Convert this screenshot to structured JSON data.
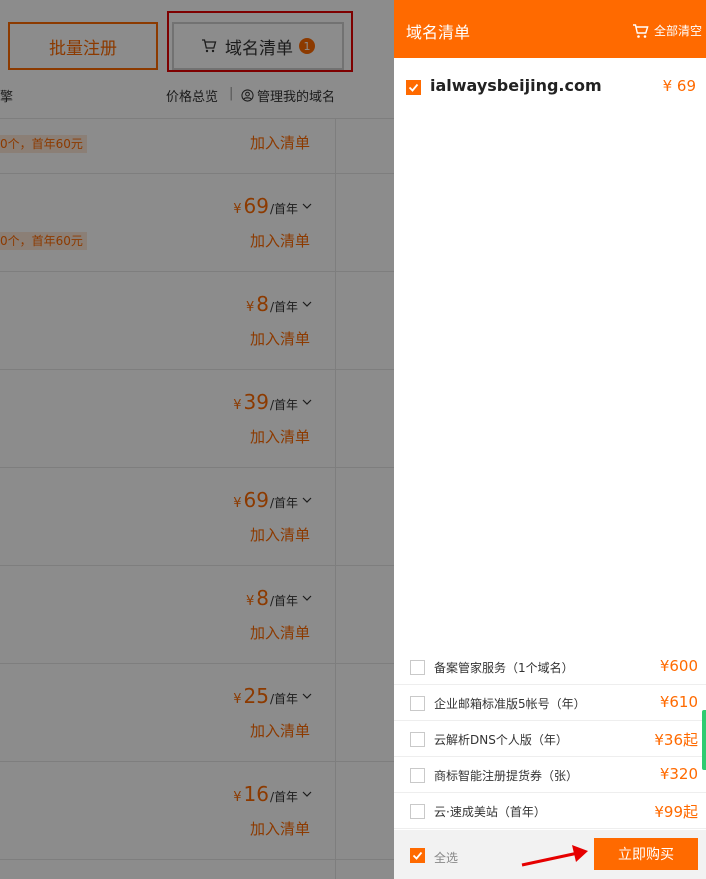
{
  "left": {
    "batch_register": "批量注册",
    "cart_button": {
      "label": "域名清单",
      "count": "1"
    },
    "subbar": {
      "clipped_text": "擎",
      "price_overview": "价格总览",
      "separator": "|",
      "manage_domains": "管理我的域名"
    },
    "rows": [
      {
        "promo": "0个，首年60元",
        "add": "加入清单"
      },
      {
        "price": "69",
        "unit": "/首年",
        "promo": "0个，首年60元",
        "add": "加入清单"
      },
      {
        "price": "8",
        "unit": "/首年",
        "add": "加入清单"
      },
      {
        "price": "39",
        "unit": "/首年",
        "add": "加入清单"
      },
      {
        "price": "69",
        "unit": "/首年",
        "add": "加入清单"
      },
      {
        "price": "8",
        "unit": "/首年",
        "add": "加入清单"
      },
      {
        "price": "25",
        "unit": "/首年",
        "add": "加入清单"
      },
      {
        "price": "16",
        "unit": "/首年",
        "add": "加入清单"
      }
    ],
    "yen": "¥"
  },
  "panel": {
    "title": "域名清单",
    "clear_all": "全部清空",
    "item": {
      "domain": "ialwaysbeijing.com",
      "price": "¥ 69",
      "checked": true
    },
    "addons": [
      {
        "label": "备案管家服务（1个域名）",
        "price": "¥600"
      },
      {
        "label": "企业邮箱标准版5帐号（年）",
        "price": "¥610"
      },
      {
        "label": "云解析DNS个人版（年）",
        "price": "¥36起"
      },
      {
        "label": "商标智能注册提货券（张）",
        "price": "¥320"
      },
      {
        "label": "云·速成美站（首年）",
        "price": "¥99起"
      }
    ],
    "select_all": "全选",
    "buy_now": "立即购买"
  },
  "colors": {
    "accent": "#ff6a00",
    "highlight": "#e60000",
    "overlay": "rgba(0,0,0,0.45)"
  }
}
